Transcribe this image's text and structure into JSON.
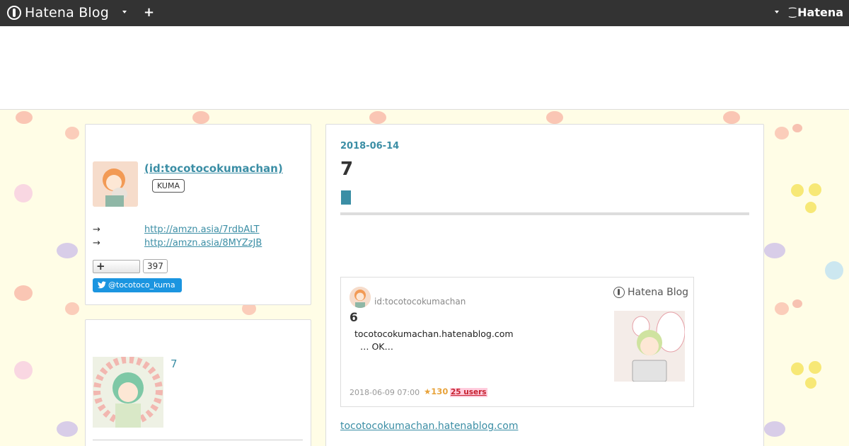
{
  "topbar": {
    "brand": "Hatena Blog",
    "add_label": "+",
    "hatena": "Hatena"
  },
  "profile": {
    "name": " (id:tocotocokumachan)",
    "badge": "KUMA",
    "links": [
      {
        "arrow": "→",
        "url": "http://amzn.asia/7rdbALT"
      },
      {
        "arrow": "→",
        "url": "http://amzn.asia/8MYZzJB"
      }
    ],
    "follow_icon": "+",
    "follower_count": "397",
    "twitter": "@tocotoco_kuma"
  },
  "sidebar2": {
    "title": "7"
  },
  "entry": {
    "date": "2018-06-14",
    "title": "7"
  },
  "embed": {
    "user": "id:tocotocokumachan",
    "logo_text": "Hatena Blog",
    "title": "6",
    "domain": "tocotocokumachan.hatenablog.com",
    "description": "… OK…",
    "time": "2018-06-09 07:00",
    "stars": "★130",
    "users": "25 users"
  },
  "blog_link": "tocotocokumachan.hatenablog.com",
  "colors": {
    "accent": "#3b8ea5",
    "topbar": "#333333",
    "background": "#fffde6",
    "twitter": "#1b95e0"
  }
}
